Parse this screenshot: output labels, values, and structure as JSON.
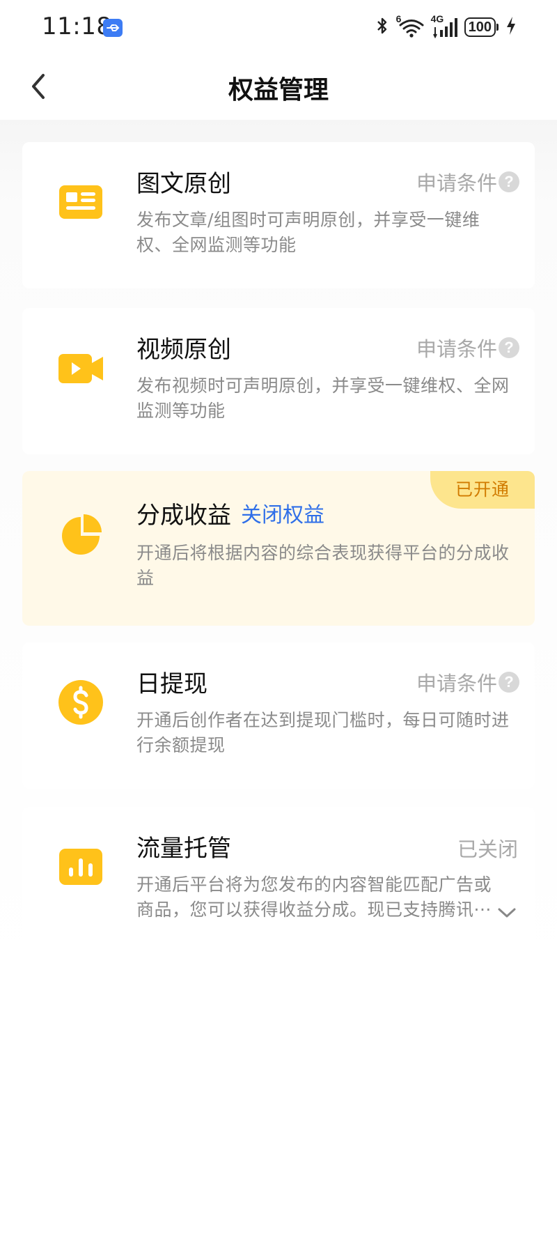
{
  "status_bar": {
    "time": "11:18",
    "network": "4G",
    "wifi_level": "6",
    "battery": "100",
    "icons": [
      "usb-icon",
      "bluetooth-icon",
      "wifi-icon",
      "signal-icon",
      "battery-icon",
      "charging-icon"
    ]
  },
  "header": {
    "title": "权益管理",
    "back_icon": "chevron-left-icon"
  },
  "colors": {
    "accent_yellow": "#ffc21a",
    "link_blue": "#2f6fe8",
    "active_card_bg": "#fff9e8",
    "badge_bg": "#fde58d",
    "badge_text": "#d17b00",
    "muted_text": "#8a8a8a"
  },
  "cards": [
    {
      "title": "图文原创",
      "desc": "发布文章/组图时可声明原创，并享受一键维权、全网监测等功能",
      "action": "申请条件",
      "icon": "article-card-icon"
    },
    {
      "title": "视频原创",
      "desc": "发布视频时可声明原创，并享受一键维权、全网监测等功能",
      "action": "申请条件",
      "icon": "video-camera-icon"
    },
    {
      "title": "分成收益",
      "link": "关闭权益",
      "badge": "已开通",
      "desc": "开通后将根据内容的综合表现获得平台的分成收益",
      "icon": "pie-chart-icon"
    },
    {
      "title": "日提现",
      "desc": "开通后创作者在达到提现门槛时，每日可随时进行余额提现",
      "action": "申请条件",
      "icon": "dollar-coin-icon"
    },
    {
      "title": "流量托管",
      "status": "已关闭",
      "desc": "开通后平台将为您发布的内容智能匹配广告或商品，您可以获得收益分成。现已支持腾讯···",
      "icon": "bar-chart-icon"
    }
  ]
}
